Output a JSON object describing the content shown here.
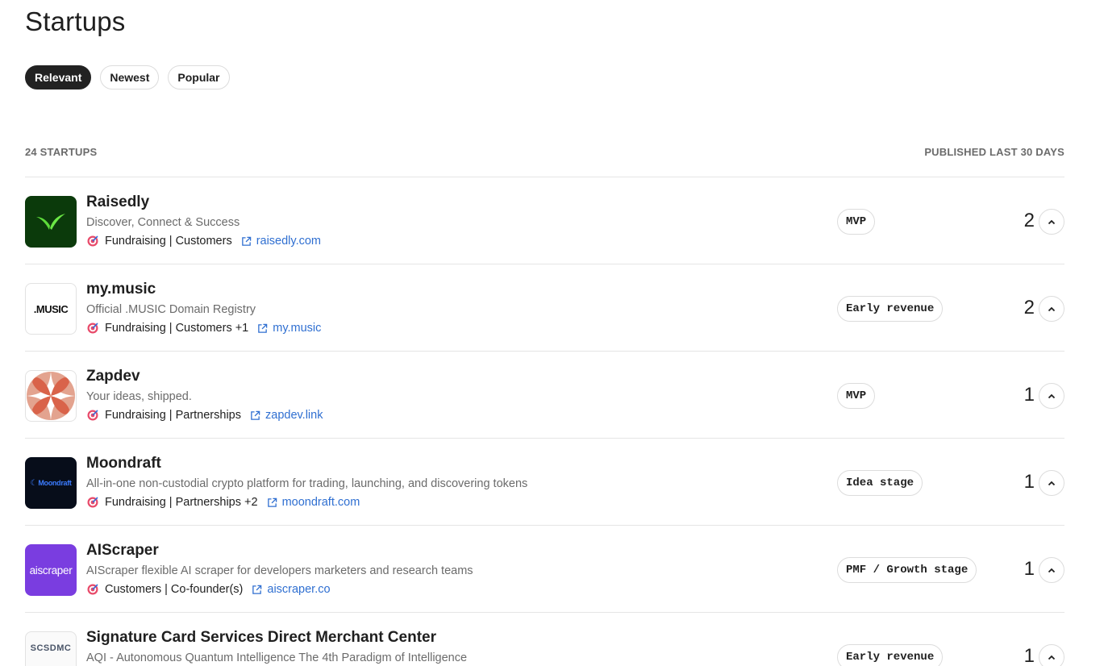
{
  "page": {
    "title": "Startups"
  },
  "filters": [
    {
      "label": "Relevant",
      "active": true
    },
    {
      "label": "Newest",
      "active": false
    },
    {
      "label": "Popular",
      "active": false
    }
  ],
  "list_header": {
    "count": "24 STARTUPS",
    "period": "PUBLISHED LAST 30 DAYS"
  },
  "startups": [
    {
      "name": "Raisedly",
      "tagline": "Discover, Connect & Success",
      "looking_for": "Fundraising | Customers",
      "url": "raisedly.com",
      "stage": "MVP",
      "votes": "2",
      "logo": "sprout-logo"
    },
    {
      "name": "my.music",
      "tagline": "Official .MUSIC Domain Registry",
      "looking_for": "Fundraising | Customers +1",
      "url": "my.music",
      "stage": "Early revenue",
      "votes": "2",
      "logo": ".MUSIC"
    },
    {
      "name": "Zapdev",
      "tagline": "Your ideas, shipped.",
      "looking_for": "Fundraising | Partnerships",
      "url": "zapdev.link",
      "stage": "MVP",
      "votes": "1",
      "logo": "star-logo"
    },
    {
      "name": "Moondraft",
      "tagline": "All-in-one non-custodial crypto platform for trading, launching, and discovering tokens",
      "looking_for": "Fundraising | Partnerships +2",
      "url": "moondraft.com",
      "stage": "Idea stage",
      "votes": "1",
      "logo": "Moondraft"
    },
    {
      "name": "AIScraper",
      "tagline": "AIScraper flexible AI scraper for developers marketers and research teams",
      "looking_for": "Customers | Co-founder(s)",
      "url": "aiscraper.co",
      "stage": "PMF / Growth stage",
      "votes": "1",
      "logo": "aiscraper"
    },
    {
      "name": "Signature Card Services Direct Merchant Center",
      "tagline": "AQI - Autonomous Quantum Intelligence The 4th Paradigm of Intelligence",
      "looking_for": "",
      "url": "",
      "stage": "Early revenue",
      "votes": "1",
      "logo": "SCSDMC"
    }
  ],
  "colors": {
    "link": "#2f6fd1",
    "active_pill": "#222222",
    "border": "#e5e5e5"
  }
}
